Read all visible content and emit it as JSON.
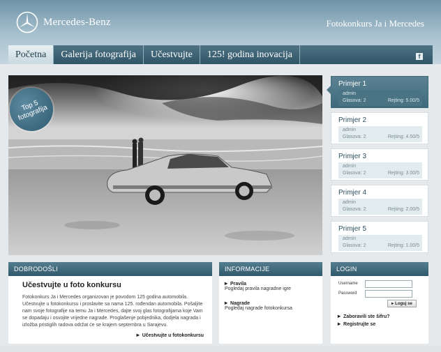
{
  "header": {
    "brand": "Mercedes-Benz",
    "site_title": "Fotokonkurs Ja i Mercedes",
    "logo_icon": "mercedes-star-icon"
  },
  "nav": {
    "items": [
      {
        "label": "Početna",
        "active": true
      },
      {
        "label": "Galerija fotografija",
        "active": false
      },
      {
        "label": "Učestvujte",
        "active": false
      },
      {
        "label": "125! godina inovacija",
        "active": false
      }
    ],
    "facebook_icon": "facebook-icon",
    "facebook_glyph": "f"
  },
  "hero": {
    "badge": "Top 5 fotografija"
  },
  "examples": [
    {
      "title": "Primjer 1",
      "author": "admin",
      "votes": "Glasova: 2",
      "rating": "Rejting: 5.00/5",
      "active": true
    },
    {
      "title": "Primjer 2",
      "author": "admin",
      "votes": "Glasova: 2",
      "rating": "Rejting: 4.50/5",
      "active": false
    },
    {
      "title": "Primjer 3",
      "author": "admin",
      "votes": "Glasova: 2",
      "rating": "Rejting: 3.00/5",
      "active": false
    },
    {
      "title": "Primjer 4",
      "author": "admin",
      "votes": "Glasova: 2",
      "rating": "Rejting: 2.00/5",
      "active": false
    },
    {
      "title": "Primjer 5",
      "author": "admin",
      "votes": "Glasova: 2",
      "rating": "Rejting: 1.00/5",
      "active": false
    }
  ],
  "welcome": {
    "header": "DOBRODOŠLI",
    "heading": "Učestvujte u foto konkursu",
    "text": "Fotokonkurs Ja i Mercedes organizovan je povodom 125 godina automobila. Učestvujte u fotokonkursu i proslavite sa nama 125. rođendan automobila. Pošaljite nam svoje fotografije na temu Ja i Mercedes, dajte svoj glas fotografijama koje Vam se dopadaju i osvojite vrijedne nagrade. Proglašenje pobjednika, dodjela nagrada i izložba pristiglih radova održat će se krajem septembra u Sarajevu.",
    "link": "Učestvujte u fotokonkursu"
  },
  "info": {
    "header": "INFORMACIJE",
    "items": [
      {
        "title": "Pravila",
        "desc": "Pogledaj pravila nagradne igre"
      },
      {
        "title": "Nagrade",
        "desc": "Pogledaj nagrade fotokonkursa"
      }
    ]
  },
  "login": {
    "header": "LOGIN",
    "username_label": "Username",
    "password_label": "Password",
    "button": "Loguj se",
    "forgot": "Zaboravili ste šifru?",
    "register": "Registrujte se"
  },
  "colors": {
    "header_top": "#6f94a8",
    "nav_bg": "#2f5566",
    "panel_head": "#3f6a7c"
  }
}
